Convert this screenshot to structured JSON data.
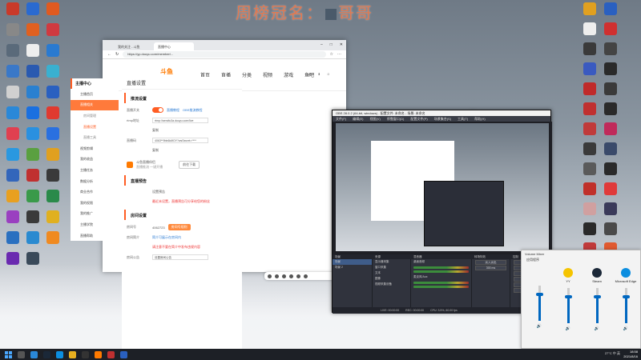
{
  "overlay": {
    "title": "周榜冠名：",
    "name_partial": "哥哥"
  },
  "desktop": {
    "left_icons": [
      {
        "label": "",
        "color": "#c93a2a"
      },
      {
        "label": "",
        "color": "#888"
      },
      {
        "label": "",
        "color": "#5a6a7a"
      },
      {
        "label": "",
        "color": "#3a78c8"
      },
      {
        "label": "",
        "color": "#d0d0d0"
      },
      {
        "label": "",
        "color": "#2a88d8"
      },
      {
        "label": "",
        "color": "#e04050"
      },
      {
        "label": "",
        "color": "#2a98e0"
      },
      {
        "label": "",
        "color": "#3366bb"
      },
      {
        "label": "",
        "color": "#e8a020"
      },
      {
        "label": "",
        "color": "#9a40c0"
      },
      {
        "label": "",
        "color": "#2a70c0"
      },
      {
        "label": "",
        "color": "#6a2ab0"
      },
      {
        "label": "",
        "color": "#2a6ad0"
      },
      {
        "label": "",
        "color": "#e06020"
      },
      {
        "label": "",
        "color": "#eee"
      },
      {
        "label": "",
        "color": "#2a5ab0"
      },
      {
        "label": "",
        "color": "#2a80d0"
      },
      {
        "label": "",
        "color": "#1a70e0"
      },
      {
        "label": "",
        "color": "#2a90e0"
      },
      {
        "label": "",
        "color": "#5aa040"
      },
      {
        "label": "",
        "color": "#c03030"
      },
      {
        "label": "",
        "color": "#3a9a4a"
      },
      {
        "label": "",
        "color": "#3a3a3a"
      },
      {
        "label": "",
        "color": "#2a8ad0"
      },
      {
        "label": "",
        "color": "#3a4a5a"
      },
      {
        "label": "",
        "color": "#e05a20"
      },
      {
        "label": "",
        "color": "#d03a40"
      },
      {
        "label": "",
        "color": "#2a7ad0"
      },
      {
        "label": "",
        "color": "#3ab0d0"
      },
      {
        "label": "",
        "color": "#2a60c0"
      },
      {
        "label": "",
        "color": "#e03a30"
      },
      {
        "label": "",
        "color": "#2a70e0"
      },
      {
        "label": "",
        "color": "#e0a020"
      },
      {
        "label": "",
        "color": "#3a3a3a"
      },
      {
        "label": "",
        "color": "#2a8a4a"
      },
      {
        "label": "",
        "color": "#e0b020"
      },
      {
        "label": "",
        "color": "#f08a20"
      }
    ],
    "right_icons": [
      {
        "color": "#e0a020"
      },
      {
        "color": "#2a60c0"
      },
      {
        "color": "#eee"
      },
      {
        "color": "#d03030"
      },
      {
        "color": "#3a3a3a"
      },
      {
        "color": "#444"
      },
      {
        "color": "#3a5ac0"
      },
      {
        "color": "#2a2a2a"
      },
      {
        "color": "#c02a2a"
      },
      {
        "color": "#3a3a3a"
      },
      {
        "color": "#c03030"
      },
      {
        "color": "#2a2a2a"
      },
      {
        "color": "#c03a3a"
      },
      {
        "color": "#c02a5a"
      },
      {
        "color": "#3a3a3a"
      },
      {
        "color": "#3a4a6a"
      },
      {
        "color": "#5a5a5a"
      },
      {
        "color": "#2a2a2a"
      },
      {
        "color": "#c0302a"
      },
      {
        "color": "#e03a3a"
      },
      {
        "color": "#d0a0a0"
      },
      {
        "color": "#3a3a5a"
      },
      {
        "color": "#2a2a2a"
      },
      {
        "color": "#4a4a4a"
      },
      {
        "color": "#c03a3a"
      },
      {
        "color": "#e05a30"
      }
    ]
  },
  "browser": {
    "tabs": [
      "我的关注 - 斗鱼",
      "直播中心"
    ],
    "url": "https://yp.douyu.com/member/...",
    "logo": "斗鱼",
    "nav": [
      "首页",
      "直播",
      "分类",
      "视频",
      "游戏",
      "鱼吧"
    ],
    "nav_right": [
      "",
      "",
      ""
    ],
    "sidebar": {
      "header": "主播中心",
      "items": [
        {
          "label": "主播首页",
          "type": "item"
        },
        {
          "label": "直播相关",
          "type": "active"
        },
        {
          "label": "房间管理",
          "type": "sub"
        },
        {
          "label": "直播设置",
          "type": "subact"
        },
        {
          "label": "直播工具",
          "type": "sub"
        },
        {
          "label": "视频剪辑",
          "type": "item"
        },
        {
          "label": "我的收益",
          "type": "item"
        },
        {
          "label": "主播任务",
          "type": "item"
        },
        {
          "label": "数据分析",
          "type": "item"
        },
        {
          "label": "商业合作",
          "type": "item"
        },
        {
          "label": "我的权限",
          "type": "item"
        },
        {
          "label": "我的推广",
          "type": "item"
        },
        {
          "label": "主播学院",
          "type": "item"
        },
        {
          "label": "直播帮助",
          "type": "item"
        }
      ]
    },
    "main": {
      "title": "直播设置",
      "sec1": "推流设置",
      "toggle_label": "直播开关",
      "links": [
        "直播教程",
        "OBS推流教程"
      ],
      "rtmp_label": "rtmp地址",
      "rtmp_value": "rtmp://sendtc3a.douyu.com/live",
      "copy": "复制",
      "key_label": "直播码",
      "key_value": "4063**9bb6k6fOY?wsSecret=****",
      "copy2": "复制",
      "tool_title": "斗鱼直播伴侣",
      "tool_desc": "直播推流 一键开播",
      "tool_btn": "前往下载",
      "sec2": "直播预告",
      "preview_label": "设置预告",
      "preview_warn": "最近未设置，直播预告可分享给您的粉丝",
      "sec3": "房间设置",
      "room_label": "房间号",
      "room_value": "4062723",
      "room_btn": "房间号规则",
      "notice_label": "房间简介",
      "notice_text": "简介可展示在房间内",
      "notice_warn": "请注意不要在简介中发布违规内容",
      "announce_label": "房间公告",
      "announce_text": "设置房间公告"
    }
  },
  "obs": {
    "title": "OBS 28.0.2 (64-bit, windows) - 配置文件: 未命名 - 场景: 未命名",
    "menu": [
      "文件(F)",
      "编辑(E)",
      "视图(V)",
      "停靠窗口(D)",
      "配置文件(P)",
      "场景集合(S)",
      "工具(T)",
      "帮助(H)"
    ],
    "docks": [
      "场景",
      "来源",
      "混音器",
      "转场特效",
      "控制"
    ],
    "scenes": [
      "场景",
      "场景 2"
    ],
    "sources": [
      "显示器采集",
      "窗口采集",
      "文本",
      "图像",
      "视频采集设备"
    ],
    "mixer": [
      "桌面音频",
      "麦克风/Aux"
    ],
    "transition": "淡入淡出",
    "duration": "300 ms",
    "controls": [
      "开始推流",
      "开始录制",
      "启动虚拟摄像机",
      "工作室模式",
      "设置",
      "退出"
    ],
    "status": [
      "LIVE: 00:00:00",
      "REC: 00:00:00",
      "CPU: 3.5%, 60.00 fps"
    ]
  },
  "volume": {
    "title": "Volume Mixer",
    "header": "应用程序",
    "apps": [
      {
        "name": "YY",
        "color": "#f5c400",
        "level": 0.76
      },
      {
        "name": "Steam",
        "color": "#1b2838",
        "level": 0.76
      },
      {
        "name": "Microsoft Edge",
        "color": "#0c8ee0",
        "level": 0.76
      }
    ]
  },
  "taskbar": {
    "tray": "27°C  中  英",
    "time": "18:58",
    "date": "2021/8/16"
  }
}
